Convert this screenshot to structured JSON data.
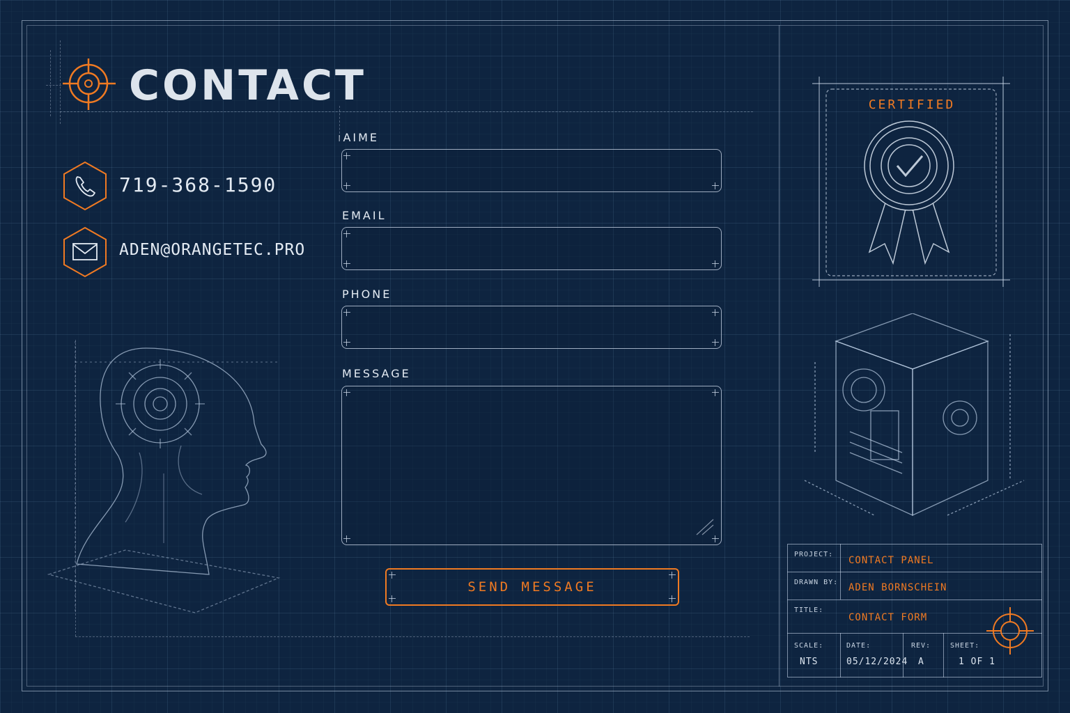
{
  "header": {
    "title": "CONTACT"
  },
  "contact_info": {
    "phone": "719-368-1590",
    "email": "ADEN@ORANGETEC.PRO"
  },
  "form": {
    "name_label": "AIME",
    "email_label": "EMAIL",
    "phone_label": "PHONE",
    "message_label": "MESSAGE",
    "name_value": "",
    "email_value": "",
    "phone_value": "",
    "message_value": "",
    "submit_label": "SEND MESSAGE"
  },
  "badge": {
    "label": "CERTIFIED"
  },
  "title_block": {
    "project_label": "PROJECT:",
    "project_value": "CONTACT PANEL",
    "drawn_by_label": "DRAWN BY:",
    "drawn_by_value": "ADEN BORNSCHEIN",
    "title_label": "TITLE:",
    "title_value": "CONTACT FORM",
    "scale_label": "SCALE:",
    "scale_value": "NTS",
    "date_label": "DATE:",
    "date_value": "05/12/2024",
    "rev_label": "REV:",
    "rev_value": "A",
    "sheet_label": "SHEET:",
    "sheet_value": "1 OF 1"
  },
  "colors": {
    "background": "#0e2440",
    "accent": "#f07a22",
    "line": "#c8d7eb"
  },
  "icons": [
    "crosshair-icon",
    "phone-icon",
    "mail-icon",
    "certified-ribbon-icon",
    "crosshair-icon"
  ]
}
